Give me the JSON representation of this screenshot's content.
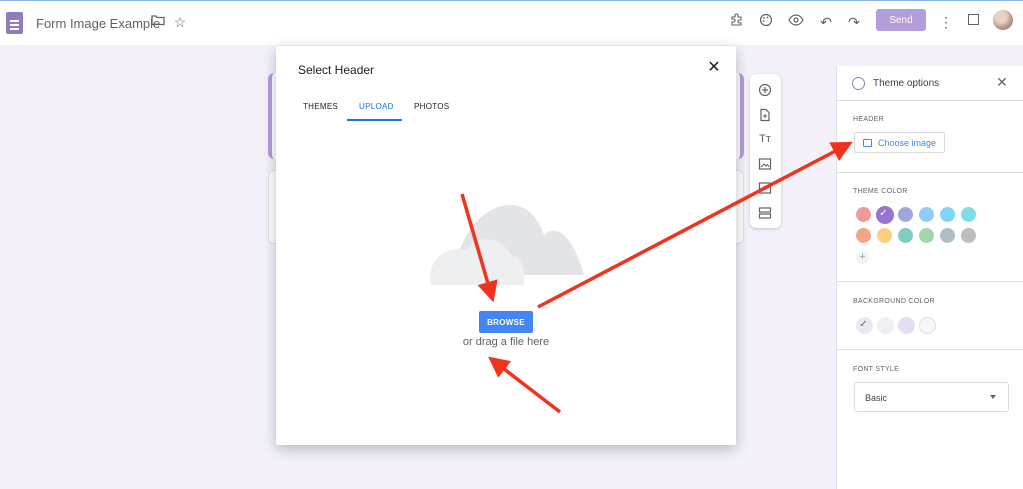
{
  "topbar": {
    "title": "Form Image Example",
    "send_label": "Send",
    "icons": [
      "folder-icon",
      "star-icon",
      "addon-icon",
      "palette-icon",
      "preview-icon",
      "undo-icon",
      "redo-icon",
      "more-icon"
    ]
  },
  "modal": {
    "title": "Select Header",
    "close": "✕",
    "tabs": [
      {
        "label": "THEMES",
        "active": false
      },
      {
        "label": "UPLOAD",
        "active": true
      },
      {
        "label": "PHOTOS",
        "active": false
      }
    ],
    "browse_label": "BROWSE",
    "drag_text": "or drag a file here"
  },
  "float_toolbar": {
    "icons": [
      "add-question-icon",
      "import-questions-icon",
      "add-title-icon",
      "add-image-icon",
      "add-video-icon",
      "add-section-icon"
    ]
  },
  "theme_panel": {
    "title": "Theme options",
    "close": "✕",
    "header_label": "HEADER",
    "choose_image_label": "Choose image",
    "theme_color_label": "THEME COLOR",
    "theme_colors": [
      "#ef9a9a",
      "#9575cd",
      "#9fa8da",
      "#90caf9",
      "#81d4fa",
      "#80deea",
      "#f4a28c",
      "#ffcc80",
      "#80cbc4",
      "#a5d6a7",
      "#b0bec5",
      "#bdbdbd"
    ],
    "selected_theme_color": "#9575cd",
    "add_color": "+",
    "background_color_label": "BACKGROUND COLOR",
    "background_colors": [
      "#ebe8f2",
      "#f1eef8",
      "#e4ddf4",
      "#f7f7f7"
    ],
    "font_style_label": "FONT STYLE",
    "font_style_value": "Basic"
  },
  "colors": {
    "accent": "#1a73e8",
    "brand": "#8e7cc3",
    "annotation_arrow": "#f0321e"
  }
}
